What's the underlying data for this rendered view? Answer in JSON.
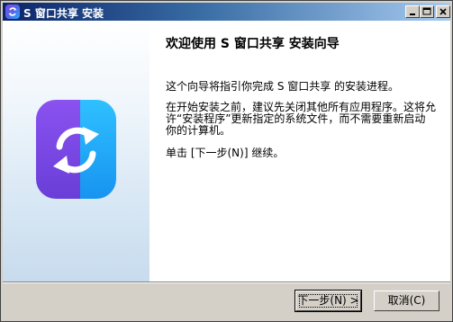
{
  "window": {
    "title": "S 窗口共享 安装",
    "icon": "app-icon"
  },
  "titlebar_buttons": {
    "minimize": "minimize-icon",
    "maximize": "maximize-icon",
    "close": "close-icon"
  },
  "banner": {
    "logo": "s-share-logo",
    "logo_colors": {
      "purple": "#7a47e6",
      "blue": "#1fb3ff",
      "arrow": "#ffffff"
    }
  },
  "content": {
    "heading": "欢迎使用 S 窗口共享 安装向导",
    "paragraph1": "这个向导将指引你完成 S 窗口共享 的安装进程。",
    "paragraph2": "在开始安装之前，建议先关闭其他所有应用程序。这将允许“安装程序”更新指定的系统文件，而不需要重新启动你的计算机。",
    "paragraph3": "单击 [下一步(N)] 继续。"
  },
  "buttons": {
    "next_label": "下一步(N) >",
    "cancel_label": "取消(C)"
  }
}
